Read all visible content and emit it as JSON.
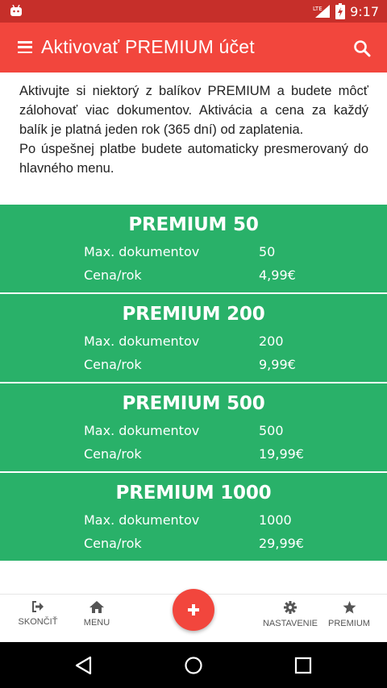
{
  "status_bar": {
    "time": "9:17",
    "network": "LTE",
    "icons": [
      "android-notification-icon",
      "lte-signal-icon",
      "battery-charging-icon"
    ]
  },
  "app_bar": {
    "title": "Aktivovať PREMIUM účet",
    "menu_icon": "hamburger-icon",
    "search_icon": "search-icon",
    "color": "#f2463d"
  },
  "intro": {
    "paragraph1": "Aktivujte si niektorý z balíkov PREMIUM a budete môcť zálohovať viac dokumentov. Aktivácia a cena za každý balík je platná jeden rok (365 dní) od zaplatenia.",
    "paragraph2": "Po úspešnej platbe budete automaticky presmerovaný do hlavného menu."
  },
  "plans": [
    {
      "name": "PREMIUM 50",
      "docs_label": "Max. dokumentov",
      "docs_value": "50",
      "price_label": "Cena/rok",
      "price_value": "4,99€"
    },
    {
      "name": "PREMIUM 200",
      "docs_label": "Max. dokumentov",
      "docs_value": "200",
      "price_label": "Cena/rok",
      "price_value": "9,99€"
    },
    {
      "name": "PREMIUM 500",
      "docs_label": "Max. dokumentov",
      "docs_value": "500",
      "price_label": "Cena/rok",
      "price_value": "19,99€"
    },
    {
      "name": "PREMIUM 1000",
      "docs_label": "Max. dokumentov",
      "docs_value": "1000",
      "price_label": "Cena/rok",
      "price_value": "29,99€"
    }
  ],
  "plan_color": "#29b169",
  "bottom_nav": {
    "quit": "SKONČIŤ",
    "menu": "MENU",
    "settings": "NASTAVENIE",
    "premium": "PREMIUM",
    "fab_icon": "plus-icon"
  },
  "system_nav": [
    "back-icon",
    "home-icon",
    "recents-icon"
  ]
}
